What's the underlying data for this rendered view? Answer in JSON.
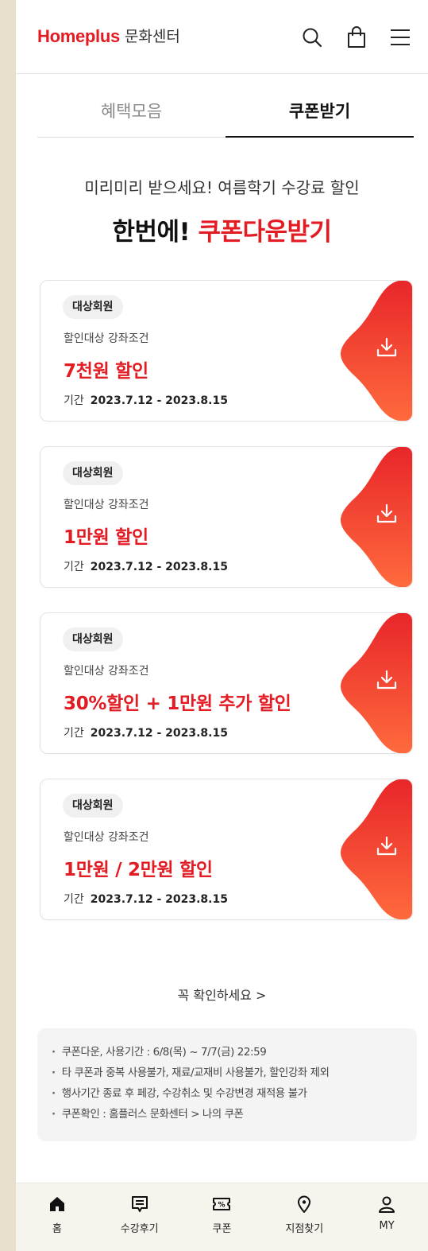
{
  "header": {
    "brand": "Homeplus",
    "sub": "문화센터",
    "icons": [
      "search-icon",
      "shopping-bag-icon",
      "menu-icon"
    ]
  },
  "tabs": [
    {
      "label": "혜택모음",
      "active": false
    },
    {
      "label": "쿠폰받기",
      "active": true
    }
  ],
  "promo": {
    "line1": "미리미리 받으세요!  여름학기 수강료 할인",
    "line2_prefix": "한번에! ",
    "line2_highlight": "쿠폰다운받기"
  },
  "coupons": [
    {
      "badge": "대상회원",
      "condition": "할인대상 강좌조건",
      "discount": "7천원 할인",
      "period_label": "기간",
      "period": "2023.7.12 - 2023.8.15"
    },
    {
      "badge": "대상회원",
      "condition": "할인대상 강좌조건",
      "discount": "1만원 할인",
      "period_label": "기간",
      "period": "2023.7.12 - 2023.8.15"
    },
    {
      "badge": "대상회원",
      "condition": "할인대상 강좌조건",
      "discount": "30%할인 + 1만원 추가 할인",
      "period_label": "기간",
      "period": "2023.7.12 - 2023.8.15"
    },
    {
      "badge": "대상회원",
      "condition": "할인대상 강좌조건",
      "discount": "1만원 / 2만원 할인",
      "period_label": "기간",
      "period": "2023.7.12 - 2023.8.15"
    }
  ],
  "notice": {
    "link": "꼭 확인하세요 >",
    "items": [
      "쿠폰다운, 사용기간 : 6/8(목) ~ 7/7(금) 22:59",
      "타 쿠폰과 중복 사용불가, 재료/교재비 사용불가, 할인강좌 제외",
      "행사기간 종료 후 페강, 수강취소 및 수강변경 재적용 불가",
      "쿠폰확인 : 홈플러스 문화센터 > 나의 쿠폰"
    ]
  },
  "bottom_nav": [
    {
      "label": "홈",
      "icon": "home-icon"
    },
    {
      "label": "수강후기",
      "icon": "review-icon"
    },
    {
      "label": "쿠폰",
      "icon": "coupon-icon"
    },
    {
      "label": "지점찾기",
      "icon": "location-icon"
    },
    {
      "label": "MY",
      "icon": "user-icon"
    }
  ],
  "colors": {
    "brand_red": "#e31b23",
    "gradient_start": "#e8262a",
    "gradient_end": "#ff6a3d"
  }
}
